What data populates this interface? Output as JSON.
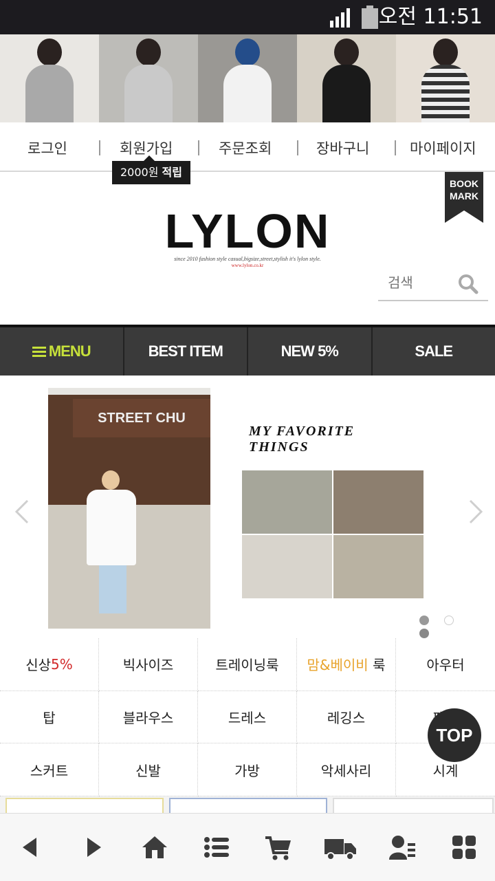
{
  "status_bar": {
    "time": "오전 11:51"
  },
  "top_nav": {
    "items": [
      "로그인",
      "회원가입",
      "주문조회",
      "장바구니",
      "마이페이지"
    ],
    "signup_tip": {
      "amount": "2000원",
      "label": "적립"
    }
  },
  "bookmark": {
    "line1": "BOOK",
    "line2": "MARK"
  },
  "logo": {
    "text": "LYLON",
    "tagline": "since 2010 fashion style casual,bigsize,street,stylish it's lylon style.",
    "url": "www.lylon.co.kr"
  },
  "search": {
    "placeholder": "검색"
  },
  "main_menu": {
    "menu": "MENU",
    "best": "BEST ITEM",
    "new": "NEW 5%",
    "sale": "SALE"
  },
  "slider": {
    "storefront_sign": "STREET CHU",
    "favorite_title": "MY FAVORITE THINGS",
    "active_dot": 0,
    "dot_count": 3
  },
  "categories": {
    "row1": {
      "new_prefix": "신상",
      "new_suffix": "5%",
      "bigsize": "빅사이즈",
      "training": "트레이닝룩",
      "mom_baby": "맘&베이비",
      "mom_suffix": " 룩",
      "outer": "아우터"
    },
    "row2": {
      "top": "탑",
      "blouse": "블라우스",
      "dress": "드레스",
      "leggings": "레깅스",
      "pants": "팬츠"
    },
    "row3": {
      "skirt": "스커트",
      "shoes": "신발",
      "bag": "가방",
      "accessory": "악세사리",
      "watch": "시계"
    }
  },
  "top_button": "TOP",
  "bottom_bar": [
    "back-icon",
    "forward-icon",
    "home-icon",
    "list-icon",
    "cart-icon",
    "delivery-icon",
    "user-icon",
    "grid-icon"
  ],
  "colors": {
    "accent_menu": "#c6e03a",
    "red": "#d2292a",
    "orange": "#e8a32b",
    "menu_bar": "#3a3a3a"
  }
}
